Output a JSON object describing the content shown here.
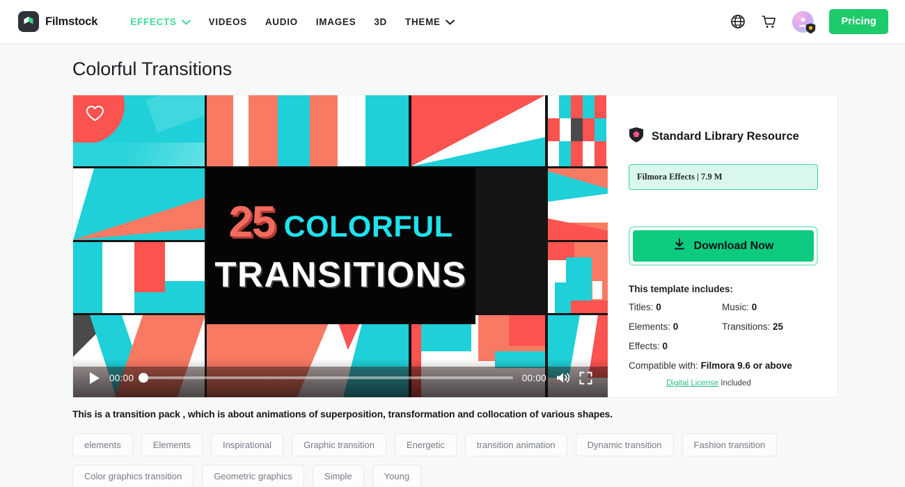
{
  "header": {
    "brand": "Filmstock",
    "nav": [
      {
        "label": "EFFECTS",
        "active": true,
        "caret": true
      },
      {
        "label": "VIDEOS",
        "active": false,
        "caret": false
      },
      {
        "label": "AUDIO",
        "active": false,
        "caret": false
      },
      {
        "label": "IMAGES",
        "active": false,
        "caret": false
      },
      {
        "label": "3D",
        "active": false,
        "caret": false
      },
      {
        "label": "THEME",
        "active": false,
        "caret": true
      }
    ],
    "pricing_label": "Pricing",
    "icons": [
      "globe-icon",
      "cart-icon",
      "avatar"
    ],
    "accent_green": "#3ddc97",
    "pricing_green": "#1ecb6b"
  },
  "page": {
    "title": "Colorful Transitions",
    "description": "This is a transition pack , which is about animations of superposition, transformation and collocation of various shapes."
  },
  "video": {
    "poster_title_number": "25",
    "poster_title_word1": "COLORFUL",
    "poster_title_word2": "TRANSITIONS",
    "current_time": "00:00",
    "duration": "00:00",
    "progress_percent": 0,
    "colors": {
      "cyan": "#1fd0d8",
      "red": "#fa5350",
      "salmon": "#f97a63",
      "white": "#ffffff",
      "dark": "#4a4a4a"
    }
  },
  "sidebar": {
    "resource_type": "Standard Library Resource",
    "badge": "Filmora Effects | 7.9 M",
    "download_label": "Download Now",
    "includes_title": "This template includes:",
    "includes": [
      {
        "label": "Titles:",
        "value": "0"
      },
      {
        "label": "Music:",
        "value": "0"
      },
      {
        "label": "Elements:",
        "value": "0"
      },
      {
        "label": "Transitions:",
        "value": "25"
      },
      {
        "label": "Effects:",
        "value": "0"
      }
    ],
    "compatible_label": "Compatible with:",
    "compatible_value": "Filmora 9.6 or above",
    "license_link": "Digital License",
    "license_suffix": "Included"
  },
  "tags": [
    "elements",
    "Elements",
    "Inspirational",
    "Graphic transition",
    "Energetic",
    "transition animation",
    "Dynamic transition",
    "Fashion transition",
    "Color graphics transition",
    "Geometric graphics",
    "Simple",
    "Young"
  ]
}
